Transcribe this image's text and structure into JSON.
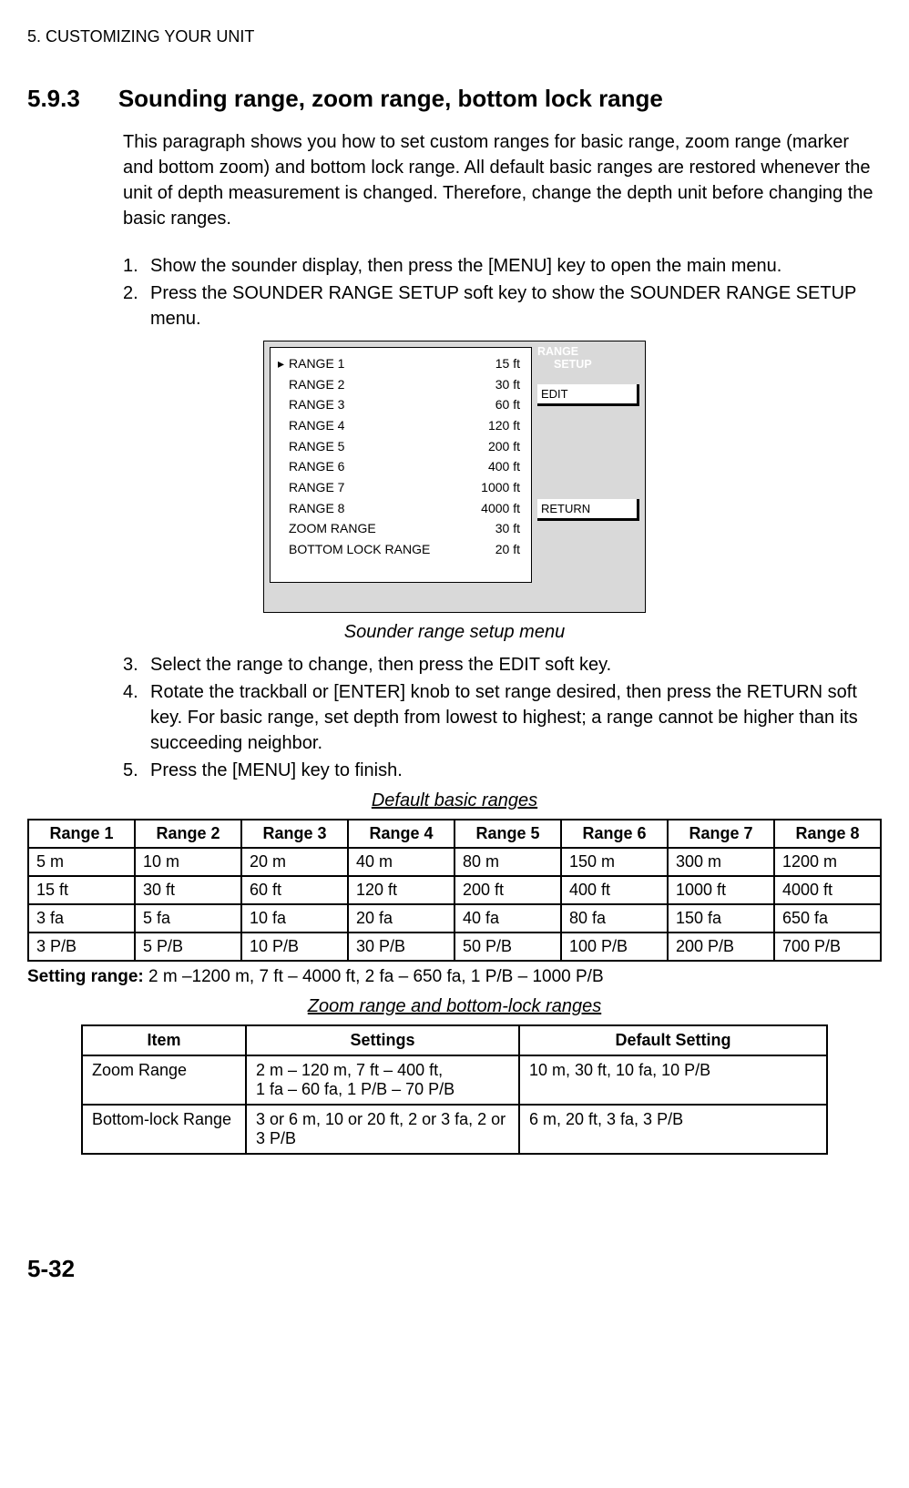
{
  "chapter": "5. CUSTOMIZING YOUR UNIT",
  "section_number": "5.9.3",
  "section_title": "Sounding range, zoom range, bottom lock range",
  "intro_paragraph": "This paragraph shows you how to set custom ranges for basic range, zoom range (marker and bottom zoom) and bottom lock range. All default basic ranges are restored whenever the unit of depth measurement is changed. Therefore, change the depth unit before changing the basic ranges.",
  "steps_a": [
    "Show the sounder display, then press the [MENU] key to open the main menu.",
    "Press the SOUNDER RANGE SETUP soft key to show the SOUNDER RANGE SETUP menu."
  ],
  "menu": {
    "title_line1": "RANGE",
    "title_line2": "SETUP",
    "softkey_edit": "EDIT",
    "softkey_return": "RETURN",
    "rows": [
      {
        "cursor": "▸",
        "label": "RANGE 1",
        "value": "15 ft"
      },
      {
        "cursor": "",
        "label": "RANGE 2",
        "value": "30 ft"
      },
      {
        "cursor": "",
        "label": "RANGE 3",
        "value": "60 ft"
      },
      {
        "cursor": "",
        "label": "RANGE 4",
        "value": "120 ft"
      },
      {
        "cursor": "",
        "label": "RANGE 5",
        "value": "200 ft"
      },
      {
        "cursor": "",
        "label": "RANGE 6",
        "value": "400 ft"
      },
      {
        "cursor": "",
        "label": "RANGE 7",
        "value": "1000 ft"
      },
      {
        "cursor": "",
        "label": "RANGE 8",
        "value": "4000 ft"
      },
      {
        "cursor": "",
        "label": "ZOOM RANGE",
        "value": "30 ft"
      },
      {
        "cursor": "",
        "label": "BOTTOM LOCK RANGE",
        "value": "20 ft"
      }
    ]
  },
  "figure_caption": "Sounder range setup menu",
  "steps_b": [
    "Select the range to change, then press the EDIT soft key.",
    "Rotate the trackball or [ENTER] knob to set range desired, then press the RETURN soft key. For basic range, set depth from lowest to highest; a range cannot be higher than its succeeding neighbor.",
    "Press the [MENU] key to finish."
  ],
  "table1_title": "Default basic ranges",
  "table1_headers": [
    "Range 1",
    "Range 2",
    "Range 3",
    "Range 4",
    "Range 5",
    "Range 6",
    "Range 7",
    "Range 8"
  ],
  "table1_rows": [
    [
      "5 m",
      "10 m",
      "20 m",
      "40 m",
      "80 m",
      "150 m",
      "300 m",
      "1200 m"
    ],
    [
      "15 ft",
      "30 ft",
      "60 ft",
      "120 ft",
      "200 ft",
      "400 ft",
      "1000 ft",
      "4000 ft"
    ],
    [
      "3 fa",
      "5 fa",
      "10 fa",
      "20 fa",
      "40 fa",
      "80 fa",
      "150 fa",
      "650 fa"
    ],
    [
      "3 P/B",
      "5 P/B",
      "10 P/B",
      "30 P/B",
      "50 P/B",
      "100 P/B",
      "200 P/B",
      "700 P/B"
    ]
  ],
  "setting_range_label": "Setting range:",
  "setting_range_text": " 2 m –1200 m, 7 ft – 4000 ft, 2 fa – 650 fa, 1 P/B – 1000 P/B",
  "table2_title": "Zoom range and bottom-lock ranges",
  "table2_headers": [
    "Item",
    "Settings",
    "Default Setting"
  ],
  "table2_rows": [
    [
      "Zoom Range",
      "2 m – 120 m, 7 ft – 400 ft,\n1 fa – 60 fa, 1 P/B – 70 P/B",
      "10 m, 30 ft, 10 fa, 10 P/B"
    ],
    [
      "Bottom-lock Range",
      "3 or 6 m, 10 or 20 ft, 2 or 3 fa, 2 or 3 P/B",
      "6 m, 20 ft, 3 fa, 3 P/B"
    ]
  ],
  "page_number": "5-32"
}
